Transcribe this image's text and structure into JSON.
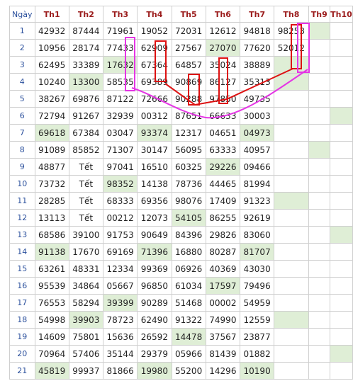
{
  "headers": [
    "Ngày",
    "Th1",
    "Th2",
    "Th3",
    "Th4",
    "Th5",
    "Th6",
    "Th7",
    "Th8",
    "Th9",
    "Th10"
  ],
  "rows": [
    {
      "day": "1",
      "cells": [
        "42932",
        "87444",
        "71961",
        "19052",
        "72031",
        "12612",
        "94818",
        "98253",
        "",
        ""
      ],
      "hl": [
        9
      ]
    },
    {
      "day": "2",
      "cells": [
        "10956",
        "28174",
        "77433",
        "62909",
        "27567",
        "27070",
        "77620",
        "52012",
        "",
        ""
      ],
      "hl": [
        6
      ]
    },
    {
      "day": "3",
      "cells": [
        "62495",
        "33389",
        "17632",
        "67364",
        "64857",
        "35024",
        "38889",
        "",
        "",
        ""
      ],
      "hl": [
        3,
        8
      ]
    },
    {
      "day": "4",
      "cells": [
        "10240",
        "13300",
        "58535",
        "69389",
        "90869",
        "86127",
        "35313",
        "",
        "",
        ""
      ],
      "hl": [
        2,
        8
      ]
    },
    {
      "day": "5",
      "cells": [
        "38267",
        "69876",
        "87122",
        "72666",
        "90288",
        "97850",
        "49735",
        "",
        "",
        ""
      ],
      "hl": []
    },
    {
      "day": "6",
      "cells": [
        "72794",
        "91267",
        "32939",
        "00312",
        "87651",
        "66633",
        "30003",
        "",
        "",
        ""
      ],
      "hl": [
        10
      ]
    },
    {
      "day": "7",
      "cells": [
        "69618",
        "67384",
        "03047",
        "93374",
        "12317",
        "04651",
        "04973",
        "",
        "",
        ""
      ],
      "hl": [
        1,
        4,
        7
      ]
    },
    {
      "day": "8",
      "cells": [
        "91089",
        "85852",
        "71307",
        "30147",
        "56095",
        "63333",
        "40957",
        "",
        "",
        ""
      ],
      "hl": [
        9
      ]
    },
    {
      "day": "9",
      "cells": [
        "48877",
        "Tết",
        "97041",
        "16510",
        "60325",
        "29226",
        "09466",
        "",
        "",
        ""
      ],
      "hl": [
        6
      ]
    },
    {
      "day": "10",
      "cells": [
        "73732",
        "Tết",
        "98352",
        "14138",
        "78736",
        "44465",
        "81994",
        "",
        "",
        ""
      ],
      "hl": [
        3
      ]
    },
    {
      "day": "11",
      "cells": [
        "28285",
        "Tết",
        "68333",
        "69356",
        "98076",
        "17409",
        "91323",
        "",
        "",
        ""
      ],
      "hl": [
        8
      ]
    },
    {
      "day": "12",
      "cells": [
        "13113",
        "Tết",
        "00212",
        "12073",
        "54105",
        "86255",
        "92619",
        "",
        "",
        ""
      ],
      "hl": [
        5
      ]
    },
    {
      "day": "13",
      "cells": [
        "68586",
        "39100",
        "91753",
        "90649",
        "84396",
        "29826",
        "83060",
        "",
        "",
        ""
      ],
      "hl": [
        10
      ]
    },
    {
      "day": "14",
      "cells": [
        "91138",
        "17670",
        "69169",
        "71396",
        "16880",
        "80287",
        "81707",
        "",
        "",
        ""
      ],
      "hl": [
        1,
        4,
        7
      ]
    },
    {
      "day": "15",
      "cells": [
        "63261",
        "48331",
        "12334",
        "99369",
        "06926",
        "40369",
        "43030",
        "",
        "",
        ""
      ],
      "hl": []
    },
    {
      "day": "16",
      "cells": [
        "95539",
        "34864",
        "05667",
        "96850",
        "61034",
        "17597",
        "79496",
        "",
        "",
        ""
      ],
      "hl": [
        6
      ]
    },
    {
      "day": "17",
      "cells": [
        "76553",
        "58294",
        "39399",
        "90289",
        "51468",
        "00002",
        "54959",
        "",
        "",
        ""
      ],
      "hl": [
        3
      ]
    },
    {
      "day": "18",
      "cells": [
        "54998",
        "39903",
        "78723",
        "62490",
        "91322",
        "74990",
        "12559",
        "",
        "",
        ""
      ],
      "hl": [
        2,
        8
      ]
    },
    {
      "day": "19",
      "cells": [
        "14609",
        "75801",
        "15636",
        "26592",
        "14478",
        "37567",
        "23877",
        "",
        "",
        ""
      ],
      "hl": [
        5
      ]
    },
    {
      "day": "20",
      "cells": [
        "70964",
        "57406",
        "35144",
        "29379",
        "05966",
        "81439",
        "01882",
        "",
        "",
        ""
      ],
      "hl": [
        10
      ]
    },
    {
      "day": "21",
      "cells": [
        "45819",
        "99937",
        "81866",
        "19980",
        "55200",
        "14296",
        "10190",
        "",
        "",
        ""
      ],
      "hl": [
        1,
        4,
        7
      ]
    }
  ],
  "colors": {
    "highlight": "#dfeed6",
    "header": "#9b1c1c",
    "day": "#2a4f9c",
    "box_red": "#dd1111",
    "box_magenta": "#e535e5"
  }
}
